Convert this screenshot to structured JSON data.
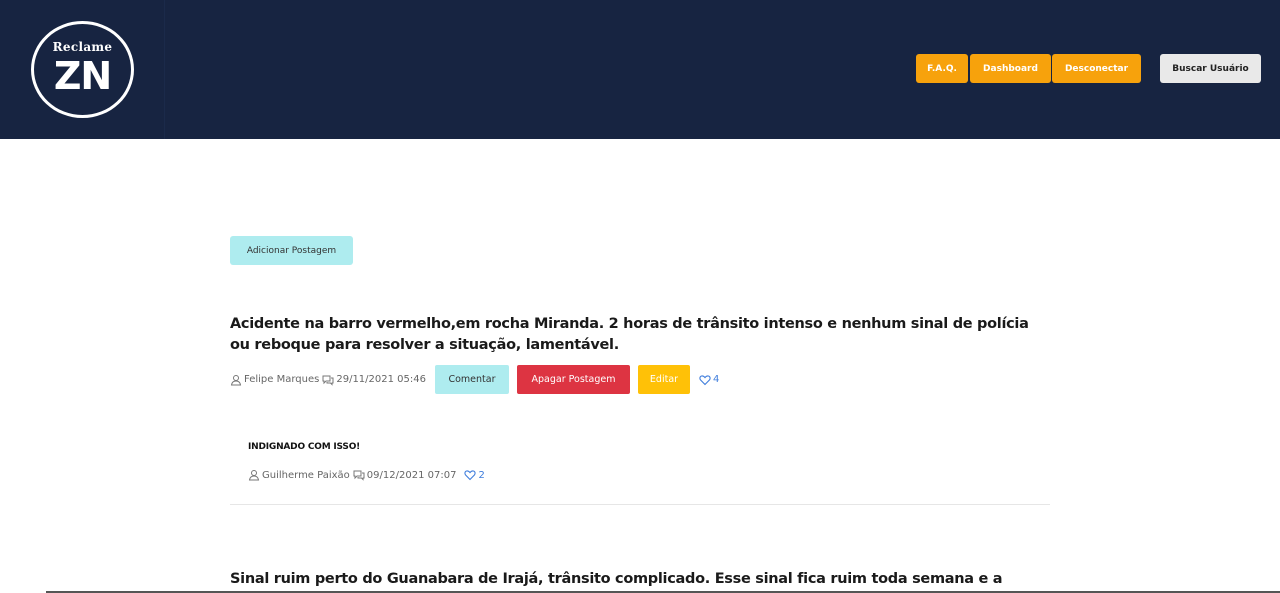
{
  "header": {
    "logo_top": "Reclame",
    "logo_main": "ZN",
    "nav": {
      "faq": "F.A.Q.",
      "dashboard": "Dashboard",
      "logout": "Desconectar",
      "search_user": "Buscar Usuário"
    }
  },
  "main": {
    "add_post_label": "Adicionar Postagem",
    "posts": [
      {
        "title": "Acidente na barro vermelho,em rocha Miranda. 2 horas de trânsito intenso e nenhum sinal de polícia ou reboque para resolver a situação, lamentável.",
        "author": "Felipe Marques",
        "datetime": "29/11/2021 05:46",
        "comment_label": "Comentar",
        "delete_label": "Apagar Postagem",
        "edit_label": "Editar",
        "likes": "4",
        "comments": [
          {
            "text": "INDIGNADO COM ISSO!",
            "author": "Guilherme Paixão",
            "datetime": "09/12/2021 07:07",
            "likes": "2"
          }
        ]
      },
      {
        "title": "Sinal ruim perto do Guanabara de Irajá, trânsito complicado. Esse sinal fica ruim toda semana e a prefeitura não faz"
      }
    ]
  },
  "colors": {
    "header_bg": "#172441",
    "nav_orange": "#f7a20c",
    "info_cyan": "#aeecef",
    "danger_red": "#dd3442",
    "warning_yellow": "#ffc107",
    "like_blue": "#3f7ddc"
  }
}
